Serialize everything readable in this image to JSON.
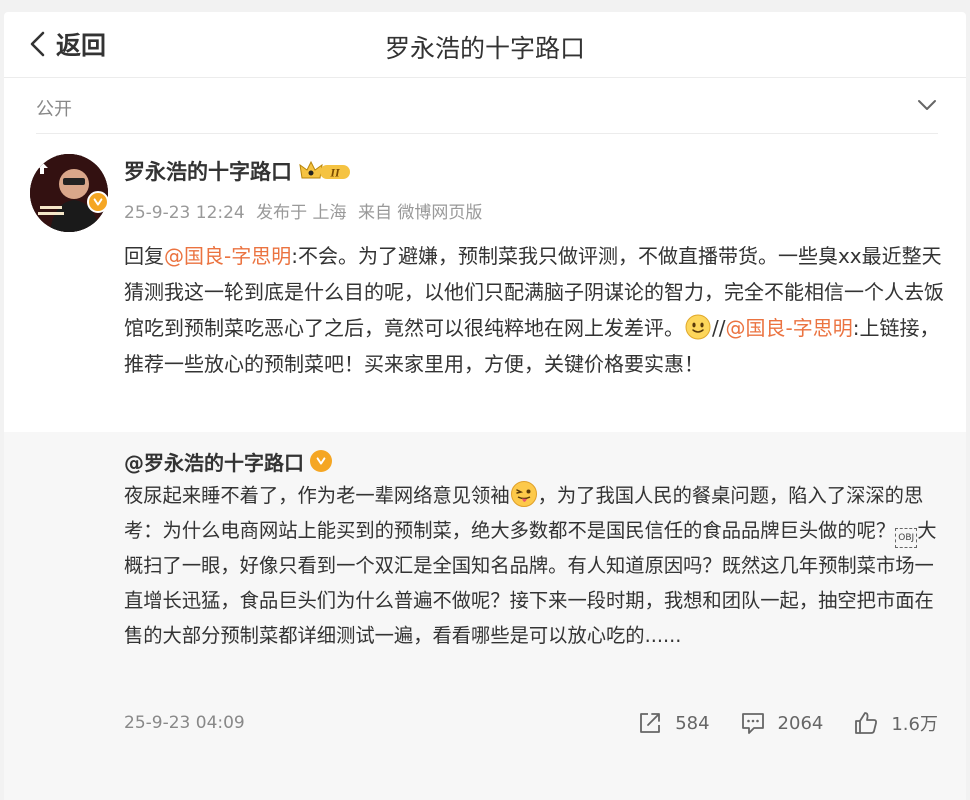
{
  "header": {
    "back_label": "返回",
    "title": "罗永浩的十字路口"
  },
  "visibility": {
    "label": "公开"
  },
  "post": {
    "author": "罗永浩的十字路口",
    "vip_level": "II",
    "meta": {
      "time": "25-9-23 12:24",
      "published_in": "发布于 上海",
      "source": "来自 微博网页版"
    },
    "content": {
      "reply_prefix": "回复",
      "mention1": "@国良-字思明",
      "text1": ":不会。为了避嫌，预制菜我只做评测，不做直播带货。一些臭xx最近整天猜测我这一轮到底是什么目的呢，以他们只配满脑子阴谋论的智力，完全不能相信一个人去饭馆吃到预制菜吃恶心了之后，竟然可以很纯粹地在网上发差评。",
      "text2": "//",
      "mention2": "@国良-字思明",
      "text3": ":上链接，推荐一些放心的预制菜吧！买来家里用，方便，关键价格要实惠！"
    }
  },
  "repost": {
    "author": "@罗永浩的十字路口",
    "text1": "夜尿起来睡不着了，作为老一辈网络意见领袖",
    "text2": "，为了我国人民的餐桌问题，陷入了深深的思考：为什么电商网站上能买到的预制菜，绝大多数都不是国民信任的食品品牌巨头做的呢？",
    "obj_glyph": "OBJ",
    "text3": "大概扫了一眼，好像只看到一个双汇是全国知名品牌。有人知道原因吗？既然这几年预制菜市场一直增长迅猛，食品巨头们为什么普遍不做呢？接下来一段时期，我想和团队一起，抽空把市面在售的大部分预制菜都详细测试一遍，看看哪些是可以放心吃的......",
    "time": "25-9-23 04:09",
    "actions": {
      "share": "584",
      "comment": "2064",
      "like": "1.6万"
    }
  },
  "colors": {
    "mention": "#eb7340",
    "badge": "#f5a623"
  }
}
